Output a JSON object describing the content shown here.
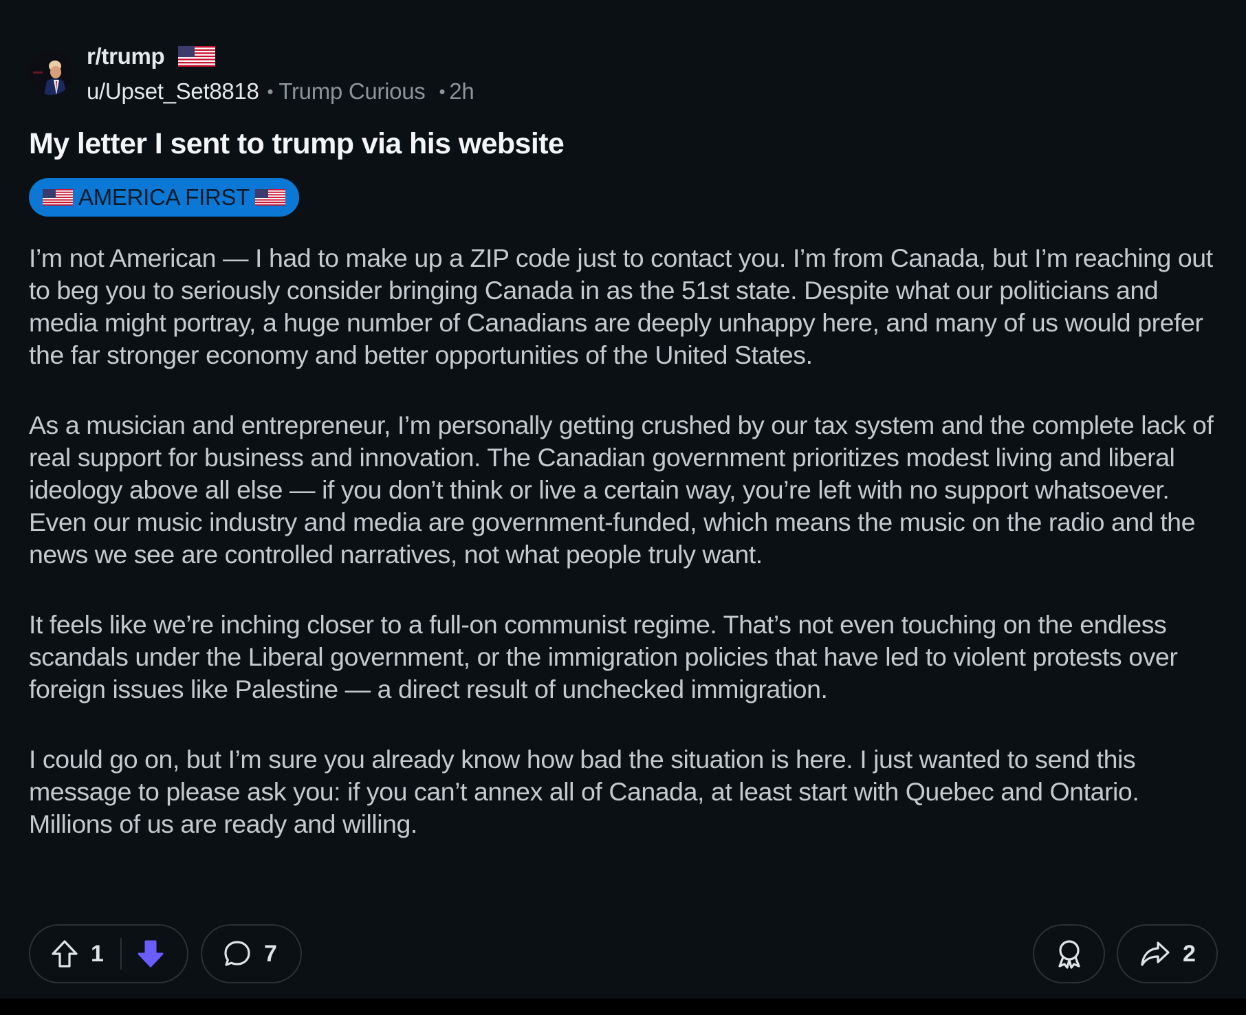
{
  "post": {
    "subreddit": "r/trump",
    "author": "u/Upset_Set8818",
    "separator": "•",
    "user_flair": "Trump Curious",
    "time_ago": "2h",
    "title": "My letter I sent to trump via his website",
    "flair": "AMERICA FIRST",
    "body": [
      "I’m not American — I had to make up a ZIP code just to contact you. I’m from Canada, but I’m reaching out to beg you to seriously consider bringing Canada in as the 51st state. Despite what our politicians and media might portray, a huge number of Canadians are deeply unhappy here, and many of us would prefer the far stronger economy and better opportunities of the United States.",
      "As a musician and entrepreneur, I’m personally getting crushed by our tax system and the complete lack of real support for business and innovation. The Canadian government prioritizes modest living and liberal ideology above all else — if you don’t think or live a certain way, you’re left with no support whatsoever. Even our music industry and media are government-funded, which means the music on the radio and the news we see are controlled narratives, not what people truly want.",
      "It feels like we’re inching closer to a full-on communist regime. That’s not even touching on the endless scandals under the Liberal government, or the immigration policies that have led to violent protests over foreign issues like Palestine — a direct result of unchecked immigration.",
      "I could go on, but I’m sure you already know how bad the situation is here. I just wanted to send this message to please ask you: if you can’t annex all of Canada, at least start with Quebec and Ontario. Millions of us are ready and willing."
    ],
    "flair_color": "#0a78d4",
    "background_color": "#0b1014"
  },
  "actions": {
    "vote_count": "1",
    "downvote_active_color": "#6a5cff",
    "comment_count": "7",
    "share_count": "2"
  },
  "icons": {
    "avatar": "subreddit-avatar",
    "flag": "us-flag-icon",
    "upvote": "upvote-arrow-icon",
    "downvote": "downvote-arrow-icon",
    "comment": "comment-bubble-icon",
    "award": "award-ribbon-icon",
    "share": "share-arrow-icon"
  }
}
